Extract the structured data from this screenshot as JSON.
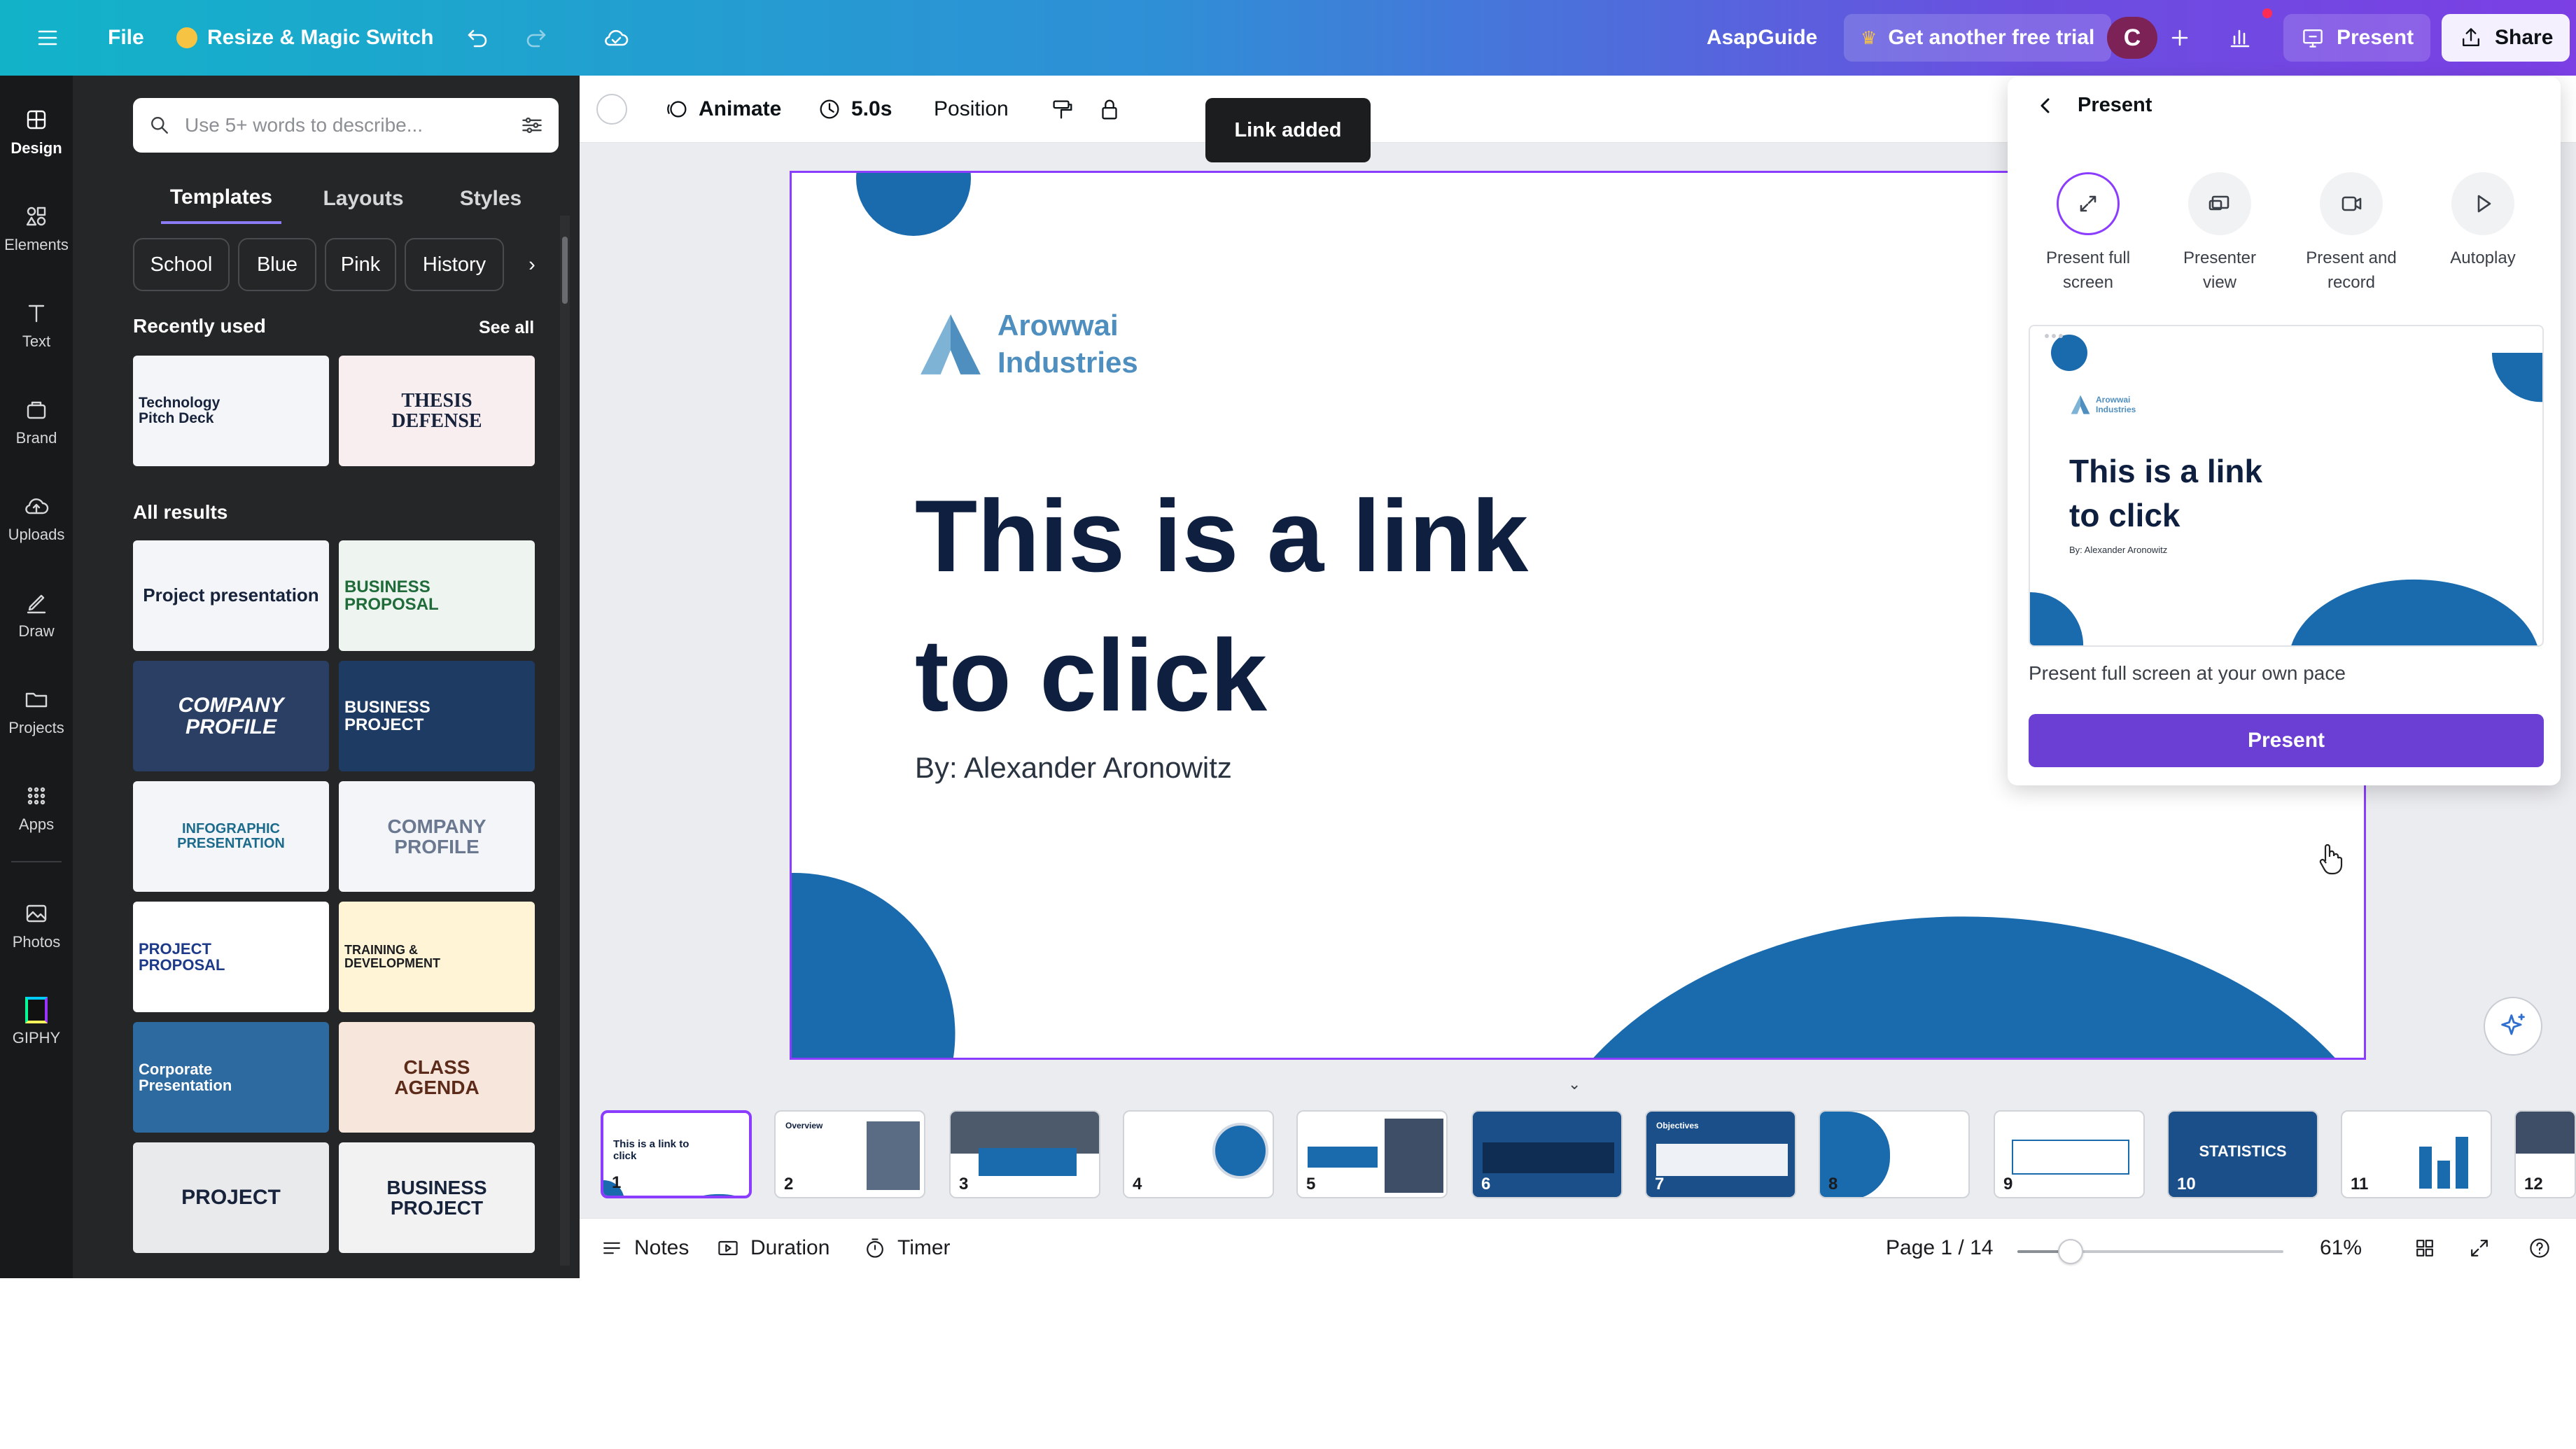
{
  "topbar": {
    "file_label": "File",
    "resize_label": "Resize & Magic Switch",
    "workspace_name": "AsapGuide",
    "trial_label": "Get another free trial",
    "avatar_letter": "C",
    "present_label": "Present",
    "share_label": "Share"
  },
  "rail": {
    "items": [
      {
        "label": "Design",
        "icon": "design-icon"
      },
      {
        "label": "Elements",
        "icon": "elements-icon"
      },
      {
        "label": "Text",
        "icon": "text-icon"
      },
      {
        "label": "Brand",
        "icon": "brand-icon"
      },
      {
        "label": "Uploads",
        "icon": "uploads-icon"
      },
      {
        "label": "Draw",
        "icon": "draw-icon"
      },
      {
        "label": "Projects",
        "icon": "projects-icon"
      },
      {
        "label": "Apps",
        "icon": "apps-icon"
      },
      {
        "label": "Photos",
        "icon": "photos-icon"
      },
      {
        "label": "GIPHY",
        "icon": "giphy-icon"
      }
    ]
  },
  "panel": {
    "search_placeholder": "Use 5+ words to describe...",
    "tabs": [
      "Templates",
      "Layouts",
      "Styles"
    ],
    "chips": [
      "School",
      "Blue",
      "Pink",
      "History"
    ],
    "recent_title": "Recently used",
    "see_all": "See all",
    "recent": [
      {
        "title": "Technology Pitch Deck"
      },
      {
        "title": "THESIS DEFENSE"
      }
    ],
    "all_title": "All results",
    "results": [
      {
        "title": "Project presentation"
      },
      {
        "title": "BUSINESS PROPOSAL"
      },
      {
        "title": "COMPANY PROFILE"
      },
      {
        "title": "BUSINESS PROJECT"
      },
      {
        "title": "INFOGRAPHIC PRESENTATION"
      },
      {
        "title": "COMPANY PROFILE"
      },
      {
        "title": "PROJECT PROPOSAL"
      },
      {
        "title": "TRAINING & DEVELOPMENT"
      },
      {
        "title": "Corporate Presentation"
      },
      {
        "title": "CLASS AGENDA"
      },
      {
        "title": "PROJECT"
      },
      {
        "title": "BUSINESS PROJECT"
      }
    ]
  },
  "context": {
    "animate": "Animate",
    "duration": "5.0s",
    "position": "Position"
  },
  "toast": "Link added",
  "slide": {
    "brand_line1": "Arowwai",
    "brand_line2": "Industries",
    "title_line1": "This is a link",
    "title_line2": "to click",
    "byline": "By: Alexander Aronowitz"
  },
  "present_panel": {
    "header": "Present",
    "options": [
      {
        "line1": "Present full",
        "line2": "screen",
        "icon": "fullscreen-icon"
      },
      {
        "line1": "Presenter",
        "line2": "view",
        "icon": "presenter-view-icon"
      },
      {
        "line1": "Present and",
        "line2": "record",
        "icon": "record-icon"
      },
      {
        "line1": "Autoplay",
        "line2": "",
        "icon": "play-icon"
      }
    ],
    "preview_brand_line1": "Arowwai",
    "preview_brand_line2": "Industries",
    "preview_title_line1": "This is a link",
    "preview_title_line2": "to click",
    "preview_byline": "By: Alexander Aronowitz",
    "description": "Present full screen at your own pace",
    "button": "Present"
  },
  "filmstrip": [
    {
      "num": "1",
      "label": "This is a link to click"
    },
    {
      "num": "2",
      "label": "Overview"
    },
    {
      "num": "3",
      "label": ""
    },
    {
      "num": "4",
      "label": ""
    },
    {
      "num": "5",
      "label": ""
    },
    {
      "num": "6",
      "label": ""
    },
    {
      "num": "7",
      "label": "Objectives"
    },
    {
      "num": "8",
      "label": ""
    },
    {
      "num": "9",
      "label": ""
    },
    {
      "num": "10",
      "label": "STATISTICS"
    },
    {
      "num": "11",
      "label": ""
    },
    {
      "num": "12",
      "label": ""
    }
  ],
  "bottombar": {
    "notes": "Notes",
    "duration": "Duration",
    "timer": "Timer",
    "page": "Page 1 / 14",
    "zoom": "61%",
    "zoom_fraction": 0.2
  },
  "colors": {
    "accent": "#8b3dff",
    "brand_blue": "#1a6aae",
    "title_navy": "#0e1f3f"
  }
}
